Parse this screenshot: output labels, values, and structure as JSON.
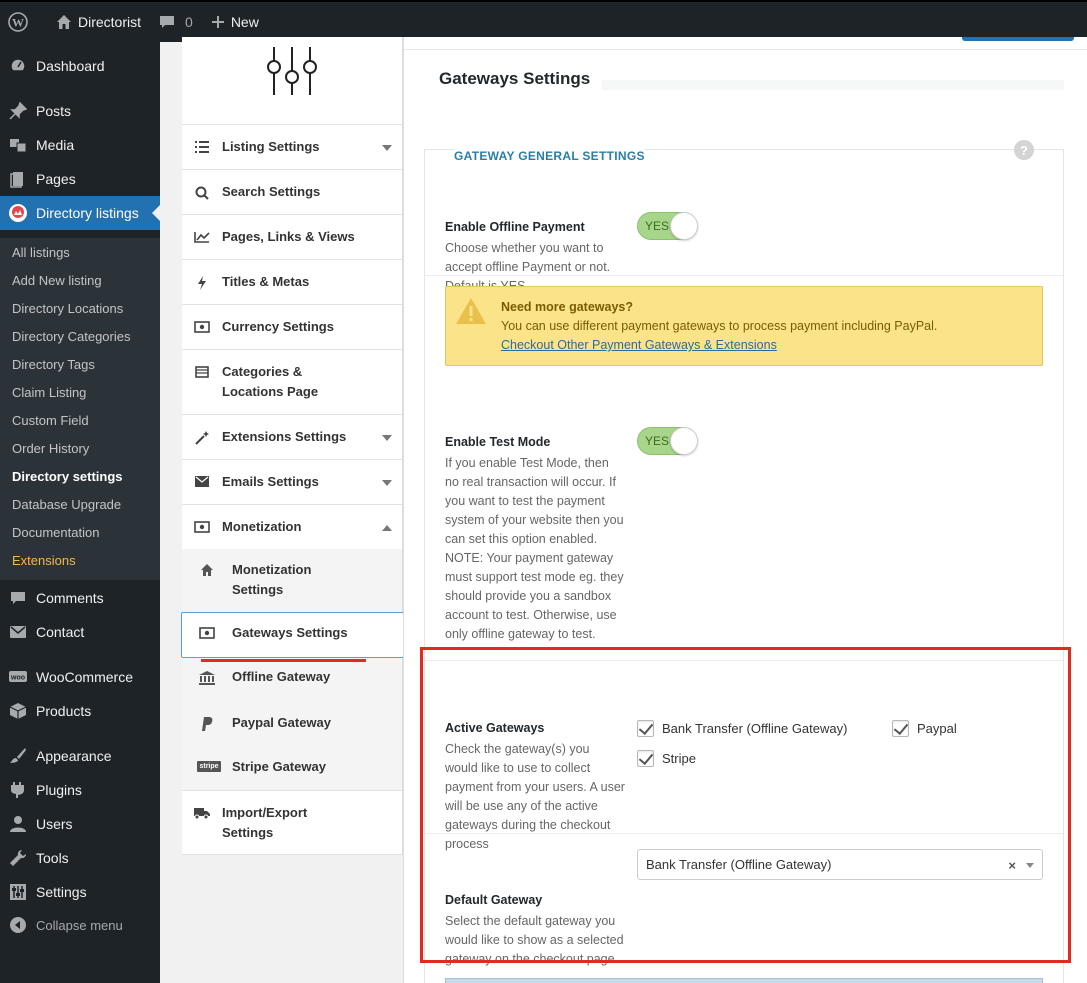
{
  "admin_bar": {
    "site_name": "Directorist",
    "comments_count": "0",
    "new_label": "New"
  },
  "sidebar": {
    "menu": [
      {
        "label": "Dashboard",
        "icon": "dashboard-icon"
      },
      {
        "label": "Posts",
        "icon": "pin-icon"
      },
      {
        "label": "Media",
        "icon": "media-icon"
      },
      {
        "label": "Pages",
        "icon": "pages-icon"
      },
      {
        "label": "Directory listings",
        "icon": "directory-icon"
      },
      {
        "label": "Comments",
        "icon": "comment-icon"
      },
      {
        "label": "Contact",
        "icon": "mail-icon"
      },
      {
        "label": "WooCommerce",
        "icon": "woo-icon"
      },
      {
        "label": "Products",
        "icon": "box-icon"
      },
      {
        "label": "Appearance",
        "icon": "brush-icon"
      },
      {
        "label": "Plugins",
        "icon": "plug-icon"
      },
      {
        "label": "Users",
        "icon": "user-icon"
      },
      {
        "label": "Tools",
        "icon": "wrench-icon"
      },
      {
        "label": "Settings",
        "icon": "sliders-icon"
      },
      {
        "label": "Collapse menu",
        "icon": "collapse-icon"
      }
    ],
    "submenu": [
      "All listings",
      "Add New listing",
      "Directory Locations",
      "Directory Categories",
      "Directory Tags",
      "Claim Listing",
      "Custom Field",
      "Order History",
      "Directory settings",
      "Database Upgrade",
      "Documentation",
      "Extensions"
    ]
  },
  "settings_nav": {
    "items": [
      {
        "label": "Listing Settings"
      },
      {
        "label": "Search Settings"
      },
      {
        "label": "Pages, Links & Views"
      },
      {
        "label": "Titles & Metas"
      },
      {
        "label": "Currency Settings"
      },
      {
        "label": "Categories &",
        "label2": "Locations Page"
      },
      {
        "label": "Extensions Settings"
      },
      {
        "label": "Emails Settings"
      },
      {
        "label": "Monetization"
      },
      {
        "label": "Import/Export",
        "label2": "Settings"
      }
    ],
    "sub_items": [
      {
        "label": "Monetization",
        "label2": "Settings"
      },
      {
        "label": "Gateways Settings"
      },
      {
        "label": "Offline Gateway"
      },
      {
        "label": "Paypal Gateway"
      },
      {
        "label": "Stripe Gateway"
      }
    ],
    "stripe_badge": "stripe"
  },
  "main": {
    "page_title": "Gateways Settings",
    "section_heading": "GATEWAY GENERAL SETTINGS",
    "help": "?",
    "offline": {
      "label": "Enable Offline Payment",
      "desc": "Choose whether you want to accept offline Payment or not. Default is YES.",
      "toggle": "YES"
    },
    "notice": {
      "title": "Need more gateways?",
      "text": "You can use different payment gateways to process payment including PayPal.",
      "link": "Checkout Other Payment Gateways & Extensions"
    },
    "test_mode": {
      "label": "Enable Test Mode",
      "desc": "If you enable Test Mode, then no real transaction will occur. If you want to test the payment system of your website then you can set this option enabled. NOTE: Your payment gateway must support test mode eg. they should provide you a sandbox account to test. Otherwise, use only offline gateway to test.",
      "toggle": "YES"
    },
    "active_gateways": {
      "label": "Active Gateways",
      "desc": "Check the gateway(s) you would like to use to collect payment from your users. A user will be use any of the active gateways during the checkout process",
      "options": [
        "Bank Transfer (Offline Gateway)",
        "Paypal",
        "Stripe"
      ]
    },
    "default_gateway": {
      "label": "Default Gateway",
      "desc": "Select the default gateway you would like to show as a selected gateway on the checkout page",
      "value": "Bank Transfer (Offline Gateway)",
      "clear": "×"
    }
  },
  "colors": {
    "wp_dark": "#1d2327",
    "wp_blue": "#2271b1",
    "highlight_red": "#e12b1f",
    "toggle_green": "#a7d58a",
    "notice_yellow": "#fbe38a"
  }
}
